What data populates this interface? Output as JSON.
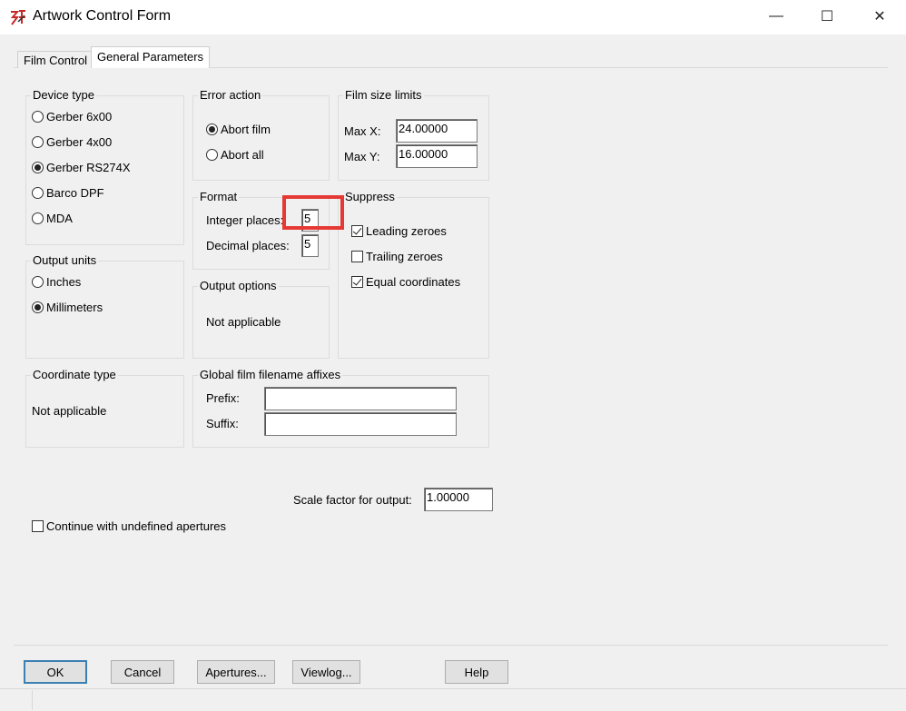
{
  "window": {
    "title": "Artwork Control Form",
    "controls": {
      "minimize": "—",
      "maximize": "☐",
      "close": "✕"
    }
  },
  "tabs": [
    {
      "label": "Film Control",
      "active": false
    },
    {
      "label": "General Parameters",
      "active": true
    }
  ],
  "device_type": {
    "label": "Device type",
    "options": [
      "Gerber 6x00",
      "Gerber 4x00",
      "Gerber RS274X",
      "Barco DPF",
      "MDA"
    ],
    "selected": "Gerber RS274X"
  },
  "error_action": {
    "label": "Error action",
    "options": [
      "Abort film",
      "Abort all"
    ],
    "selected": "Abort film"
  },
  "film_size_limits": {
    "label": "Film size limits",
    "max_x_label": "Max X:",
    "max_x_value": "24.00000",
    "max_y_label": "Max Y:",
    "max_y_value": "16.00000"
  },
  "format": {
    "label": "Format",
    "integer_label": "Integer places:",
    "integer_value": "5",
    "decimal_label": "Decimal places:",
    "decimal_value": "5"
  },
  "suppress": {
    "label": "Suppress",
    "leading_label": "Leading zeroes",
    "leading_checked": true,
    "trailing_label": "Trailing zeroes",
    "trailing_checked": false,
    "equal_label": "Equal coordinates",
    "equal_checked": true
  },
  "output_units": {
    "label": "Output units",
    "options": [
      "Inches",
      "Millimeters"
    ],
    "selected": "Millimeters"
  },
  "output_options": {
    "label": "Output options",
    "text": "Not applicable"
  },
  "coordinate_type": {
    "label": "Coordinate type",
    "text": "Not applicable"
  },
  "affixes": {
    "label": "Global film filename affixes",
    "prefix_label": "Prefix:",
    "prefix_value": "",
    "suffix_label": "Suffix:",
    "suffix_value": ""
  },
  "scale": {
    "label": "Scale factor for output:",
    "value": "1.00000"
  },
  "continue_undefined": {
    "label": "Continue with undefined apertures",
    "checked": false
  },
  "buttons": {
    "ok": "OK",
    "cancel": "Cancel",
    "apertures": "Apertures...",
    "viewlog": "Viewlog...",
    "help": "Help"
  },
  "colors": {
    "highlight": "#e53935",
    "default_button_border": "#3c7fb1"
  }
}
